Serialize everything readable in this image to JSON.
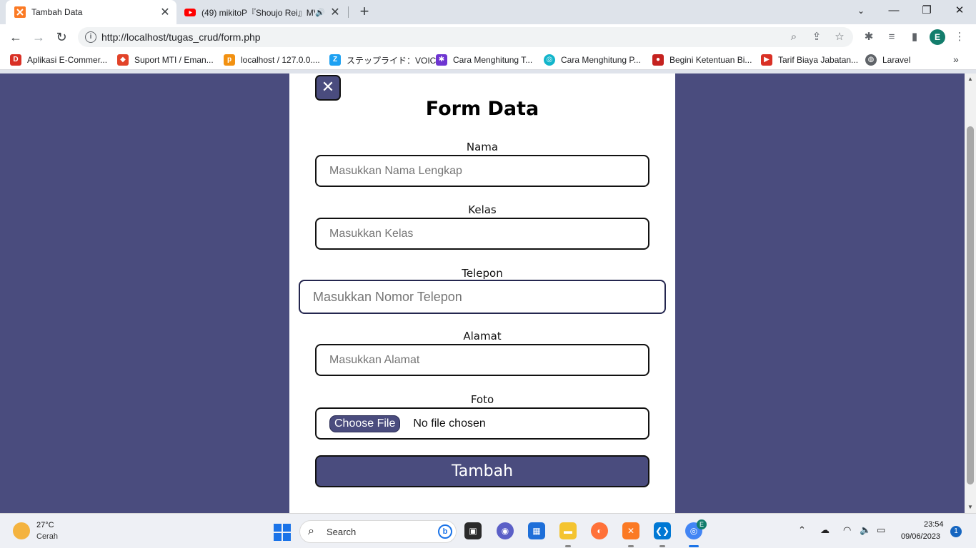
{
  "browser": {
    "tabs": [
      {
        "title": "Tambah Data",
        "active": true
      },
      {
        "title": "(49) mikitoP『Shoujo Rei』MV",
        "active": false
      }
    ],
    "url": "http://localhost/tugas_crud/form.php",
    "profile_initial": "E",
    "window_controls": {
      "minimize": "—",
      "restore": "❐",
      "close": "✕"
    },
    "bookmarks": [
      {
        "label": "Aplikasi E-Commer...",
        "icon": "dw-icon",
        "color": "#d93025"
      },
      {
        "label": "Suport MTI / Eman...",
        "icon": "gitlab-icon",
        "color": "#e24329"
      },
      {
        "label": "localhost / 127.0.0....",
        "icon": "phpmyadmin-icon",
        "color": "#f29111"
      },
      {
        "label": "ステップライド：VOIC...",
        "icon": "stepride-icon",
        "color": "#1da1f2"
      },
      {
        "label": "Cara Menghitung T...",
        "icon": "star-icon",
        "color": "#6e35d1"
      },
      {
        "label": "Cara Menghitung P...",
        "icon": "swirl-icon",
        "color": "#12b5cb"
      },
      {
        "label": "Begini Ketentuan Bi...",
        "icon": "red-square-icon",
        "color": "#c5221f"
      },
      {
        "label": "Tarif Biaya Jabatan...",
        "icon": "flag-icon",
        "color": "#d93025"
      },
      {
        "label": "Laravel",
        "icon": "globe-icon",
        "color": "#5f6368"
      }
    ]
  },
  "form": {
    "close_label": "✕",
    "title": "Form Data",
    "fields": [
      {
        "label": "Nama",
        "placeholder": "Masukkan Nama Lengkap"
      },
      {
        "label": "Kelas",
        "placeholder": "Masukkan Kelas"
      },
      {
        "label": "Telepon",
        "placeholder": "Masukkan Nomor Telepon"
      },
      {
        "label": "Alamat",
        "placeholder": "Masukkan Alamat"
      }
    ],
    "file_field": {
      "label": "Foto",
      "button": "Choose File",
      "status": "No file chosen"
    },
    "submit_label": "Tambah",
    "colors": {
      "primary": "#4a4c7e",
      "background": "#4a4c7e"
    }
  },
  "taskbar": {
    "weather_temp": "27°C",
    "weather_desc": "Cerah",
    "search_label": "Search",
    "time": "23:54",
    "date": "09/06/2023",
    "notifications": "1",
    "chrome_badge": "E"
  }
}
